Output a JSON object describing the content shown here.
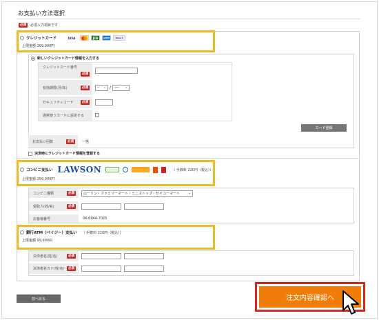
{
  "page": {
    "title": "お支払い方法選択",
    "required_badge": "必須",
    "required_note": "必須入力項目です"
  },
  "credit": {
    "label": "クレジットカード",
    "limit": "上限金額 299,999円",
    "new_card_label": "新しいクレジットカード情報を入力する",
    "fields": {
      "number_label": "クレジットカード番号",
      "expiry_label": "有効期限(月/年)",
      "security_label": "セキュリティコード",
      "default_label": "通常使うカードに設定する"
    },
    "expiry_month_value": "--",
    "expiry_year_value": "----",
    "expiry_sep": "/",
    "register_button": "カード登録",
    "count_label": "お支払い回数",
    "count_value": "一括",
    "save_card_label": "決済時にクレジットカード情報を登録する",
    "brands": [
      "VISA",
      "MC",
      "JCB",
      "AMEX",
      "Diners"
    ]
  },
  "convenience": {
    "label": "コンビニ支払い",
    "fee": "（ 手数料 220円（税込））",
    "limit": "上限金額 299,999円",
    "logo_text": "LAWSON",
    "store_label": "コンビニ種類",
    "store_value": "ローソン・ファミリーマート・ミニストップ・セイコーマート",
    "recipient_label": "受取人(姓/名)",
    "phone_label": "お客様番号",
    "phone_value": "06-6944-7025"
  },
  "atm": {
    "label": "銀行ATM（ペイジー）支払い",
    "fee": "（ 手数料 220円（税込））",
    "limit": "上限金額 99,999円",
    "name_label": "決済者名(姓/名)",
    "kana_label": "決済者名カナ(姓/名)"
  },
  "footer": {
    "back_button": "前へ戻る",
    "confirm_button": "注文内容確認へ"
  },
  "colors": {
    "highlight": "#f2b825",
    "cta": "#f07d0a",
    "cta_border": "#d9261c",
    "required": "#c62828"
  }
}
